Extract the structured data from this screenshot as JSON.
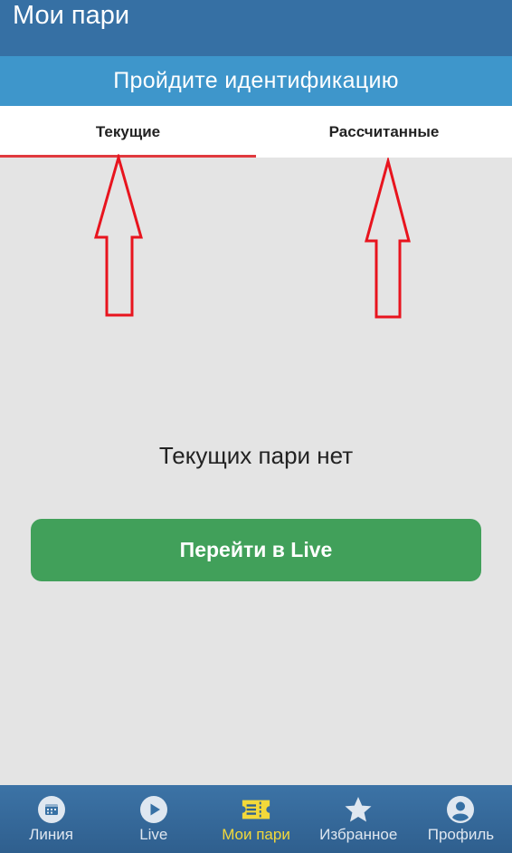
{
  "header": {
    "title": "Мои пари"
  },
  "banner": {
    "text": "Пройдите идентификацию"
  },
  "tabs": [
    {
      "label": "Текущие",
      "active": true
    },
    {
      "label": "Рассчитанные",
      "active": false
    }
  ],
  "empty_state": {
    "message": "Текущих пари нет",
    "button_label": "Перейти в Live"
  },
  "bottom_nav": [
    {
      "label": "Линия",
      "icon": "calendar-icon"
    },
    {
      "label": "Live",
      "icon": "play-icon"
    },
    {
      "label": "Мои пари",
      "icon": "ticket-icon",
      "active": true
    },
    {
      "label": "Избранное",
      "icon": "star-icon"
    },
    {
      "label": "Профиль",
      "icon": "user-icon"
    }
  ],
  "colors": {
    "header": "#3670a4",
    "banner": "#3e96cb",
    "active_tab_underline": "#e0393e",
    "cta": "#41a05a",
    "nav_active": "#f3d93a",
    "annotation_arrow": "#e8141e"
  }
}
